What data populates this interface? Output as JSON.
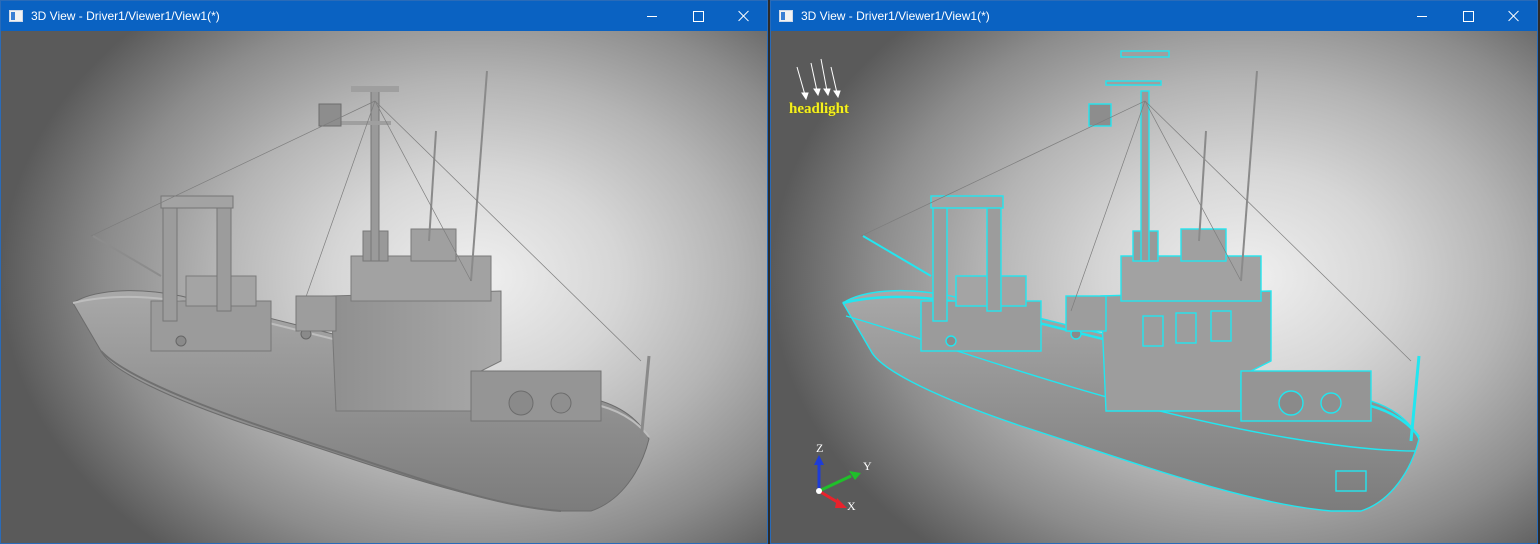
{
  "windows": [
    {
      "title": "3D View - Driver1/Viewer1/View1(*)",
      "controls": {
        "minimize": "minimize-icon",
        "maximize": "maximize-icon",
        "close": "close-icon"
      },
      "render_mode": "shaded"
    },
    {
      "title": "3D View - Driver1/Viewer1/View1(*)",
      "controls": {
        "minimize": "minimize-icon",
        "maximize": "maximize-icon",
        "close": "close-icon"
      },
      "render_mode": "shaded-with-edges",
      "edge_color": "#22e6f0",
      "light_label": "headlight",
      "triedron": {
        "x": "X",
        "y": "Y",
        "z": "Z",
        "x_color": "#e8222c",
        "y_color": "#1fbf2a",
        "z_color": "#1e3cd8"
      }
    }
  ],
  "colors": {
    "titlebar": "#0a62c2",
    "light_label": "#f5f01e",
    "model": "#9a9a9a"
  }
}
